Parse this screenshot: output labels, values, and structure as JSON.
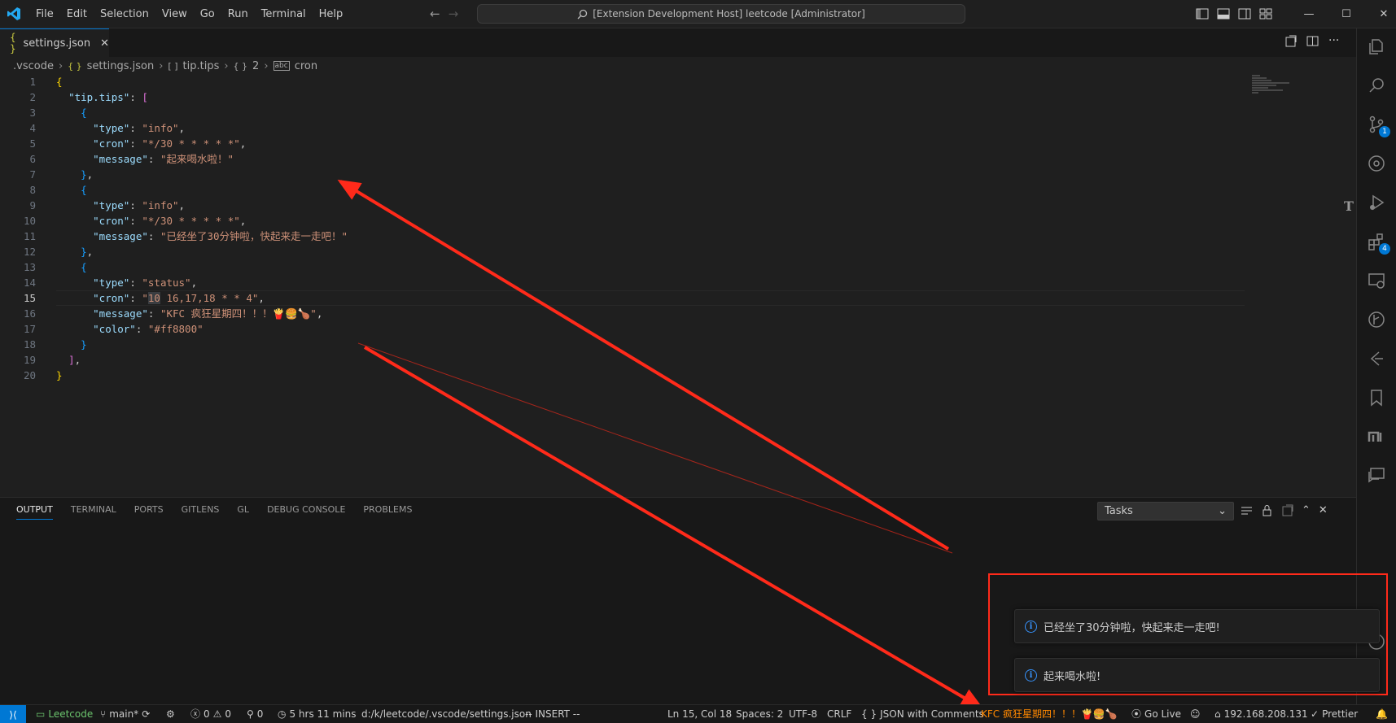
{
  "titlebar": {
    "menu": [
      "File",
      "Edit",
      "Selection",
      "View",
      "Go",
      "Run",
      "Terminal",
      "Help"
    ],
    "search_text": "[Extension Development Host] leetcode [Administrator]"
  },
  "tab": {
    "icon": "{ }",
    "label": "settings.json"
  },
  "breadcrumb": [
    ".vscode",
    "settings.json",
    "tip.tips",
    "2",
    "cron"
  ],
  "editor": {
    "line_numbers": [
      "1",
      "2",
      "3",
      "4",
      "5",
      "6",
      "7",
      "8",
      "9",
      "10",
      "11",
      "12",
      "13",
      "14",
      "15",
      "16",
      "17",
      "18",
      "19",
      "20"
    ],
    "current_line": "15"
  },
  "panel": {
    "tabs": [
      "OUTPUT",
      "TERMINAL",
      "PORTS",
      "GITLENS",
      "GL",
      "DEBUG CONSOLE",
      "PROBLEMS"
    ],
    "active_tab": "OUTPUT",
    "tasks_select": "Tasks"
  },
  "notifications": [
    {
      "message": "已经坐了30分钟啦，快起来走一走吧!"
    },
    {
      "message": "起来喝水啦!"
    }
  ],
  "statusbar": {
    "leetcode": "Leetcode",
    "branch": "main*",
    "errors": "0",
    "warnings": "0",
    "ports": "0",
    "time": "5 hrs 11 mins",
    "path": "d:/k/leetcode/.vscode/settings.json",
    "mode": "-- INSERT --",
    "position": "Ln 15, Col 18",
    "spaces": "Spaces: 2",
    "encoding": "UTF-8",
    "eol": "CRLF",
    "language": "JSON with Comments",
    "kfc": "KFC 疯狂星期四！！！🍟🍔🍗",
    "golive": "Go Live",
    "ip": "192.168.208.131",
    "prettier": "Prettier"
  },
  "colors": {
    "accent": "#0078d4",
    "kfc": "#ff8800",
    "annotation_red": "#ff2a1a"
  }
}
